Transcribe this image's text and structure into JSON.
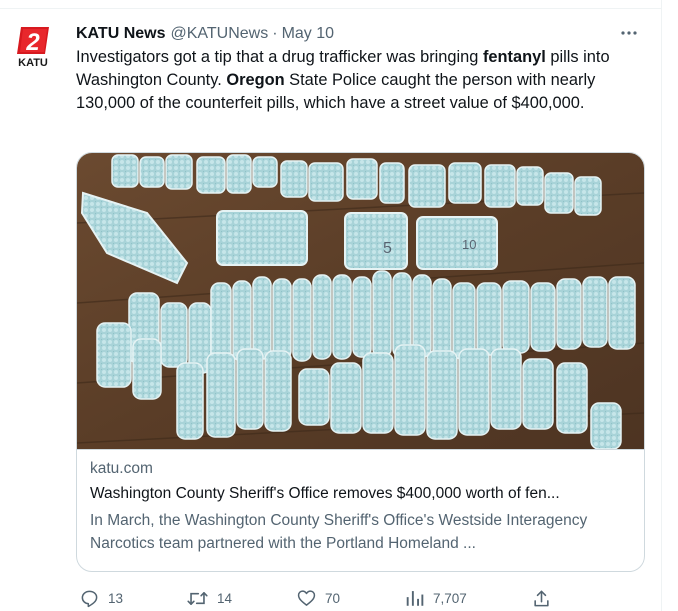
{
  "tweet": {
    "author_name": "KATU News",
    "handle": "@KATUNews",
    "separator": "·",
    "date": "May 10",
    "avatar_text": "KATU",
    "avatar_number": "2",
    "text": {
      "p1": "Investigators got a tip that a drug trafficker was bringing ",
      "b1": "fentanyl",
      "p2": " pills into Washington County. ",
      "b2": "Oregon",
      "p3": " State Police caught the person with nearly 130,000 of the counterfeit pills, which have a street value of $400,000."
    },
    "more_icon": "more-horizontal-icon"
  },
  "card": {
    "domain": "katu.com",
    "title": "Washington County Sheriff's Office removes $400,000 worth of fen...",
    "description": "In March, the Washington County Sheriff's Office's Westside Interagency Narcotics team partnered with the Portland Homeland ..."
  },
  "actions": {
    "replies": "13",
    "retweets": "14",
    "likes": "70",
    "views": "7,707"
  },
  "colors": {
    "text_primary": "#0f1419",
    "text_secondary": "#536471",
    "border": "#cfd9de",
    "brand_red": "#d7191f"
  }
}
